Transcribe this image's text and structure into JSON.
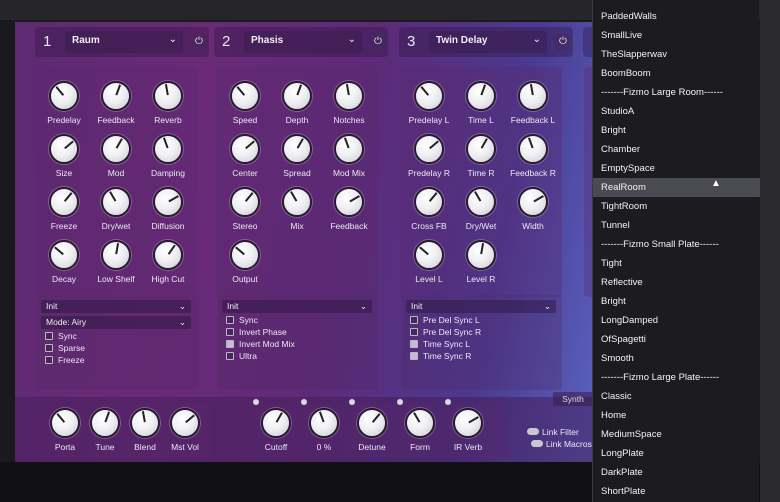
{
  "modules": [
    {
      "num": "1",
      "preset": "Raum",
      "knobs": [
        "Predelay",
        "Feedback",
        "Reverb",
        "Size",
        "Mod",
        "Damping",
        "Freeze",
        "Dry/wet",
        "Diffusion",
        "Decay",
        "Low Shelf",
        "High Cut"
      ],
      "init": "Init",
      "mode": "Mode: Airy",
      "checks": [
        {
          "label": "Sync",
          "on": false
        },
        {
          "label": "Sparse",
          "on": false
        },
        {
          "label": "Freeze",
          "on": false
        }
      ]
    },
    {
      "num": "2",
      "preset": "Phasis",
      "knobs": [
        "Speed",
        "Depth",
        "Notches",
        "Center",
        "Spread",
        "Mod Mix",
        "Stereo",
        "Mix",
        "Feedback",
        "Output"
      ],
      "init": "Init",
      "checks": [
        {
          "label": "Sync",
          "on": false
        },
        {
          "label": "Invert Phase",
          "on": false
        },
        {
          "label": "Invert Mod Mix",
          "on": true
        },
        {
          "label": "Ultra",
          "on": false
        }
      ]
    },
    {
      "num": "3",
      "preset": "Twin Delay",
      "knobs": [
        "Predelay L",
        "Time L",
        "Feedback L",
        "Predelay R",
        "Time R",
        "Feedback R",
        "Cross FB",
        "Dry/Wet",
        "Width",
        "Level L",
        "Level R"
      ],
      "init": "Init",
      "checks": [
        {
          "label": "Pre Del Sync L",
          "on": false
        },
        {
          "label": "Pre Del Sync R",
          "on": false
        },
        {
          "label": "Time Sync L",
          "on": true
        },
        {
          "label": "Time Sync R",
          "on": true
        }
      ]
    }
  ],
  "bottom": {
    "left_knobs": [
      "Porta",
      "Tune",
      "Blend",
      "Mst Vol"
    ],
    "mid_knobs": [
      "Cutoff",
      "0 %",
      "Detune",
      "Form",
      "IR Verb"
    ],
    "toggles": [
      "Link Filter",
      "Link Macros"
    ],
    "tab": "Synth"
  },
  "menu": {
    "items": [
      "PaddedWalls",
      "SmallLive",
      "TheSlapperwav",
      "BoomBoom",
      "-------Fizmo Large Room------",
      "StudioA",
      "Bright",
      "Chamber",
      "EmptySpace",
      "RealRoom",
      "TightRoom",
      "Tunnel",
      "-------Fizmo Small Plate------",
      "Tight",
      "Reflective",
      "Bright",
      "LongDamped",
      "OfSpagetti",
      "Smooth",
      "-------Fizmo Large Plate------",
      "Classic",
      "Home",
      "MediumSpace",
      "LongPlate",
      "DarkPlate",
      "ShortPlate"
    ],
    "selected": "RealRoom"
  },
  "icons": {
    "power": "power-icon",
    "chevron": "chevron-down-icon",
    "cursor": "mouse-cursor-icon"
  }
}
